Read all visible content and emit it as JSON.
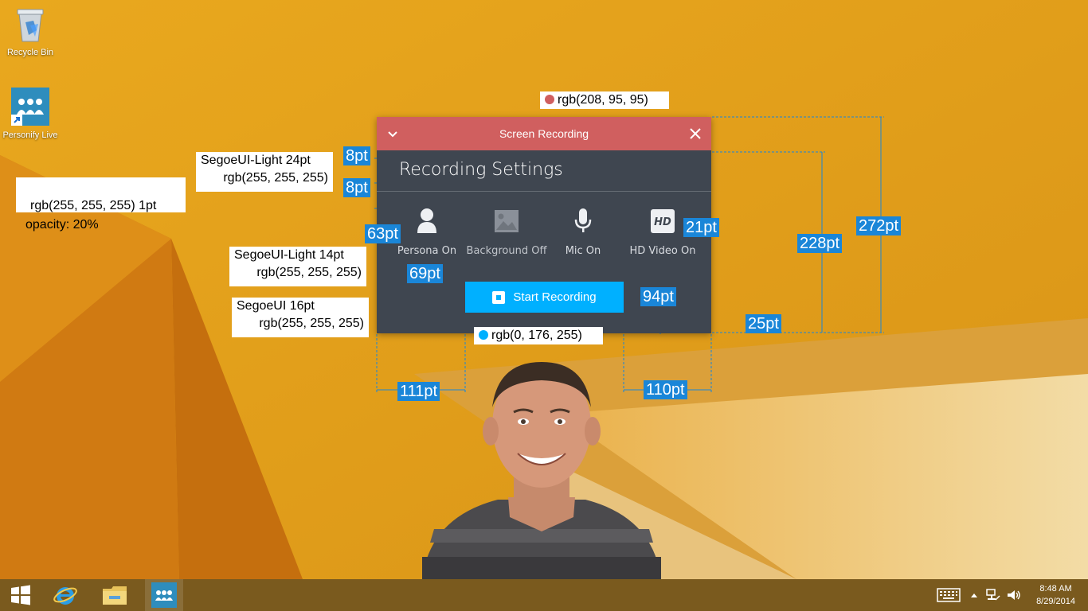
{
  "desktop": {
    "icons": [
      {
        "label": "Recycle Bin",
        "icon": "recycle-bin-icon"
      },
      {
        "label": "Personify Live",
        "icon": "personify-live-icon"
      }
    ]
  },
  "panel": {
    "window_title": "Screen Recording",
    "settings_title": "Recording Settings",
    "toggles": [
      {
        "label": "Persona On",
        "icon": "persona-icon",
        "state": "on"
      },
      {
        "label": "Background Off",
        "icon": "background-image-icon",
        "state": "off"
      },
      {
        "label": "Mic On",
        "icon": "microphone-icon",
        "state": "on"
      },
      {
        "label": "HD Video On",
        "icon": "hd-video-icon",
        "state": "on",
        "badge": "HD"
      }
    ],
    "start_button": "Start Recording",
    "colors": {
      "titlebar": "#d05f5f",
      "body": "#3f4650",
      "start_button": "#00b0ff"
    }
  },
  "annotations": {
    "notes": [
      {
        "text": "rgb(208, 95, 95)"
      },
      {
        "line1": "SegoeUI-Light 24pt",
        "line2": "rgb(255, 255, 255)"
      },
      {
        "line1": "rgb(255, 255, 255) 1pt",
        "line2": "opacity: 20%"
      },
      {
        "line1": "SegoeUI-Light 14pt",
        "line2": "rgb(255, 255, 255)"
      },
      {
        "line1": "SegoeUI 16pt",
        "line2": "rgb(255, 255, 255)"
      },
      {
        "text": "rgb(0, 176, 255)"
      }
    ],
    "measurements": [
      "8pt",
      "8pt",
      "63pt",
      "69pt",
      "21pt",
      "94pt",
      "228pt",
      "272pt",
      "25pt",
      "111pt",
      "110pt"
    ]
  },
  "taskbar": {
    "time": "8:48 AM",
    "date": "8/29/2014",
    "pinned": [
      "start-icon",
      "internet-explorer-icon",
      "file-explorer-icon",
      "personify-app-icon"
    ]
  }
}
